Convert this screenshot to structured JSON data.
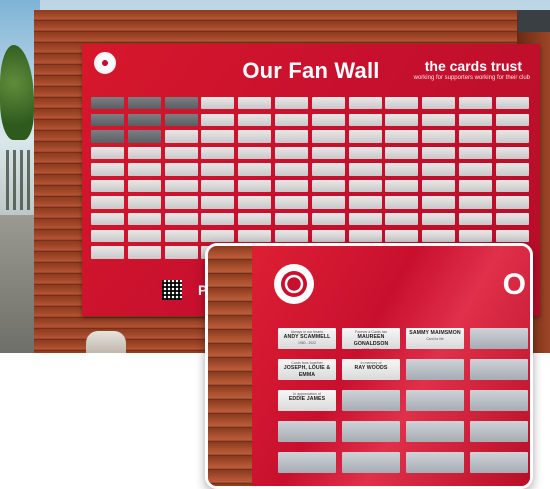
{
  "board": {
    "title": "Our Fan Wall",
    "brand": "the cards trust",
    "tagline": "working for supporters working for their club",
    "partial_text": "P",
    "columns": 12,
    "rows": 10,
    "dark_plates": 8
  },
  "inset": {
    "partial_title": "O",
    "plates": [
      {
        "pre": "Always in our hearts",
        "name": "ANDY SCAMMELL",
        "date": "1960 - 2022"
      },
      {
        "pre": "Forever a Cards fan",
        "name": "MAUREEN GONALDSON",
        "date": "1936 - 2021"
      },
      {
        "pre": "",
        "name": "SAMMY MAIMSMON",
        "date": "Card for life"
      },
      {
        "pre": "",
        "name": "",
        "date": ""
      },
      {
        "pre": "Cards fans together",
        "name": "JOSEPH, LOUIE & EMMA",
        "date": ""
      },
      {
        "pre": "In memory of",
        "name": "RAY WOODS",
        "date": ""
      },
      {
        "pre": "",
        "name": "",
        "date": ""
      },
      {
        "pre": "",
        "name": "",
        "date": ""
      },
      {
        "pre": "In appreciation of",
        "name": "EDDIE JAMES",
        "date": ""
      }
    ],
    "blank_count": 11
  }
}
